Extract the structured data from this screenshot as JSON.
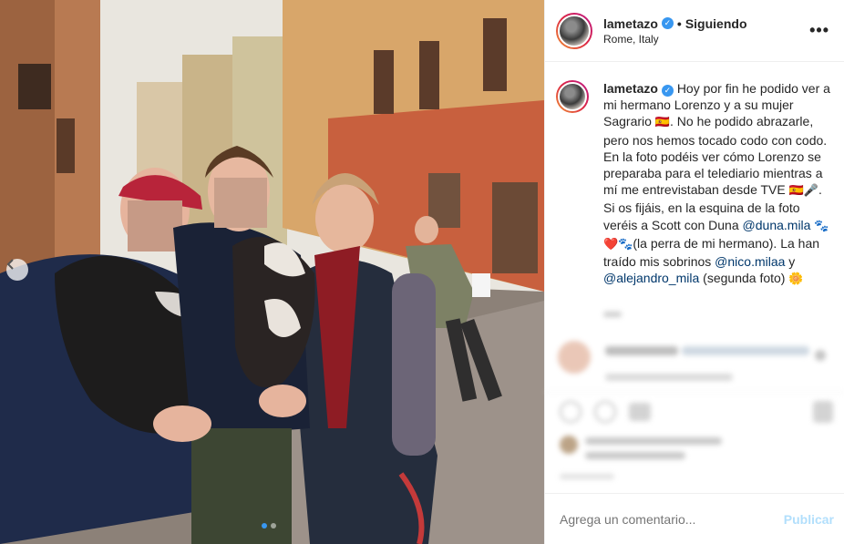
{
  "post": {
    "author": "lametazo",
    "separator": "•",
    "follow_status": "Siguiendo",
    "location": "Rome, Italy",
    "more_label": "•••"
  },
  "caption": {
    "username": "lametazo",
    "t1": "Hoy por fin he podido ver a mi hermano Lorenzo y a su mujer Sagrario ",
    "e1": "🇪🇸",
    "t2": ". No he podido abrazarle, pero nos hemos tocado codo con codo. En la foto podéis ver cómo Lorenzo se preparaba para el telediario mientras a mí me entrevistaban desde TVE ",
    "e2": "🇪🇸🎤",
    "t3": ". Si os fijáis, en la esquina de la foto veréis a Scott con Duna ",
    "m1": "@duna.mila",
    "e3": "🐾❤️🐾",
    "t4": "(la perra de mi hermano). La han traído mis sobrinos ",
    "m2": "@nico.milaa",
    "t5": " y ",
    "m3": "@alejandro_mila",
    "t6": " (segunda foto) ",
    "e4": "🌼"
  },
  "comment": {
    "placeholder": "Agrega un comentario...",
    "publish_label": "Publicar"
  },
  "carousel": {
    "current": 1,
    "total": 2
  },
  "colors": {
    "accent": "#3897f0",
    "mention": "#00376b",
    "publish_disabled": "#b2dffc"
  }
}
